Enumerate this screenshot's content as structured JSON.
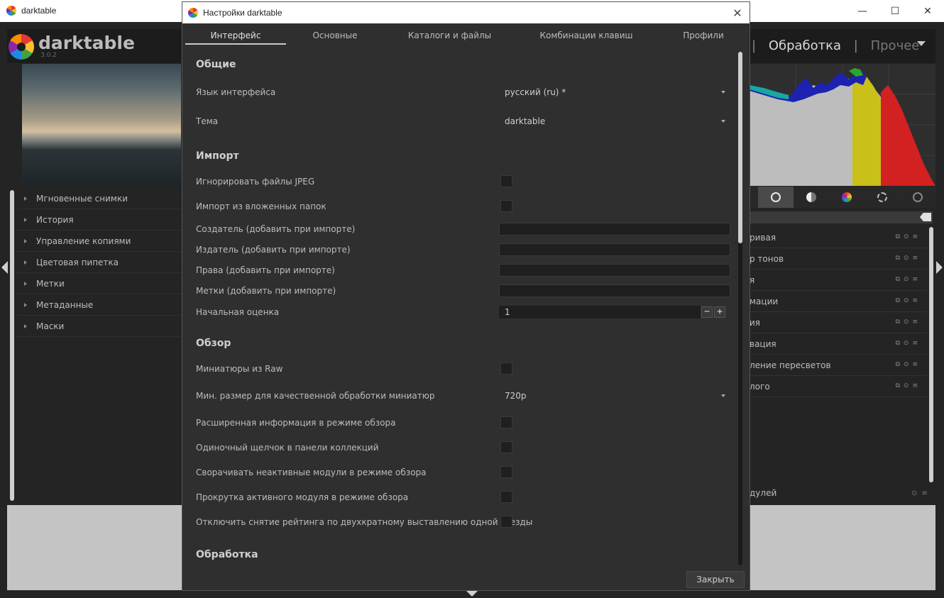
{
  "window": {
    "title": "darktable",
    "controls": {
      "minimize": "—",
      "maximize": "☐",
      "close": "✕"
    }
  },
  "app": {
    "logo_name": "darktable",
    "version": "3.0.2",
    "views": {
      "sep1": "|",
      "current": "Обработка",
      "sep2": "|",
      "other": "Прочее"
    }
  },
  "left_panel": {
    "items": [
      {
        "label": "Мгновенные снимки"
      },
      {
        "label": "История"
      },
      {
        "label": "Управление копиями"
      },
      {
        "label": "Цветовая пипетка"
      },
      {
        "label": "Метки"
      },
      {
        "label": "Метаданные"
      },
      {
        "label": "Маски"
      }
    ]
  },
  "right_panel": {
    "modules": [
      {
        "label": "ривая"
      },
      {
        "label": "р тонов"
      },
      {
        "label": "я"
      },
      {
        "label": "мации"
      },
      {
        "label": "ия"
      },
      {
        "label": "вация"
      },
      {
        "label": "ление пересветов"
      },
      {
        "label": "лого"
      }
    ],
    "bottom_label": "дулей"
  },
  "dialog": {
    "title": "Настройки darktable",
    "close_icon": "✕",
    "tabs": [
      {
        "label": "Интерфейс",
        "active": true
      },
      {
        "label": "Основные"
      },
      {
        "label": "Каталоги и файлы"
      },
      {
        "label": "Комбинации клавиш"
      },
      {
        "label": "Профили"
      }
    ],
    "sections": {
      "general": "Общие",
      "import": "Импорт",
      "lighttable": "Обзор",
      "darkroom": "Обработка"
    },
    "general": {
      "language_label": "Язык интерфейса",
      "language_value": "русский (ru) *",
      "theme_label": "Тема",
      "theme_value": "darktable"
    },
    "import": {
      "ignore_jpeg": "Игнорировать файлы JPEG",
      "recursive": "Импорт из вложенных папок",
      "creator": "Создатель (добавить при импорте)",
      "publisher": "Издатель (добавить при импорте)",
      "rights": "Права (добавить при импорте)",
      "tags": "Метки (добавить при импорте)",
      "initial_rating_label": "Начальная оценка",
      "initial_rating_value": "1",
      "minus": "−",
      "plus": "+"
    },
    "lighttable": {
      "thumbs_from_raw": "Миниатюры из Raw",
      "min_size_label": "Мин. размер для качественной обработки миниатюр",
      "min_size_value": "720p",
      "extended_info": "Расширенная информация в режиме обзора",
      "single_click": "Одиночный щелчок в панели коллекций",
      "collapse_inactive": "Сворачивать неактивные модули в режиме обзора",
      "scroll_active": "Прокрутка активного модуля в режиме обзора",
      "disable_rating_toggle": "Отключить снятие рейтинга по двухкратному выставлению одной звезды"
    },
    "close_button": "Закрыть"
  }
}
